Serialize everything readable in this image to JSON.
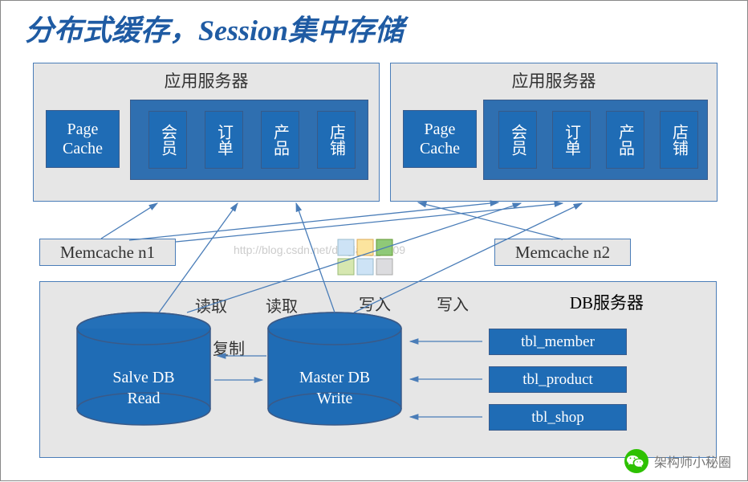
{
  "title": "分布式缓存，Session集中存储",
  "app_server_label": "应用服务器",
  "page_cache": "Page\nCache",
  "modules": {
    "member": "会员",
    "order": "订单",
    "product": "产品",
    "shop": "店铺"
  },
  "memcache_left": "Memcache n1",
  "memcache_right": "Memcache n2",
  "db_server_label": "DB服务器",
  "slave_db": "Salve DB\nRead",
  "master_db": "Master DB\nWrite",
  "tables": {
    "member": "tbl_member",
    "product": "tbl_product",
    "shop": "tbl_shop"
  },
  "labels": {
    "read": "读取",
    "write": "写入",
    "replicate": "复制"
  },
  "watermark": "http://blog.csdn.net/dinglang_2009",
  "footer": "架构师小秘圈"
}
